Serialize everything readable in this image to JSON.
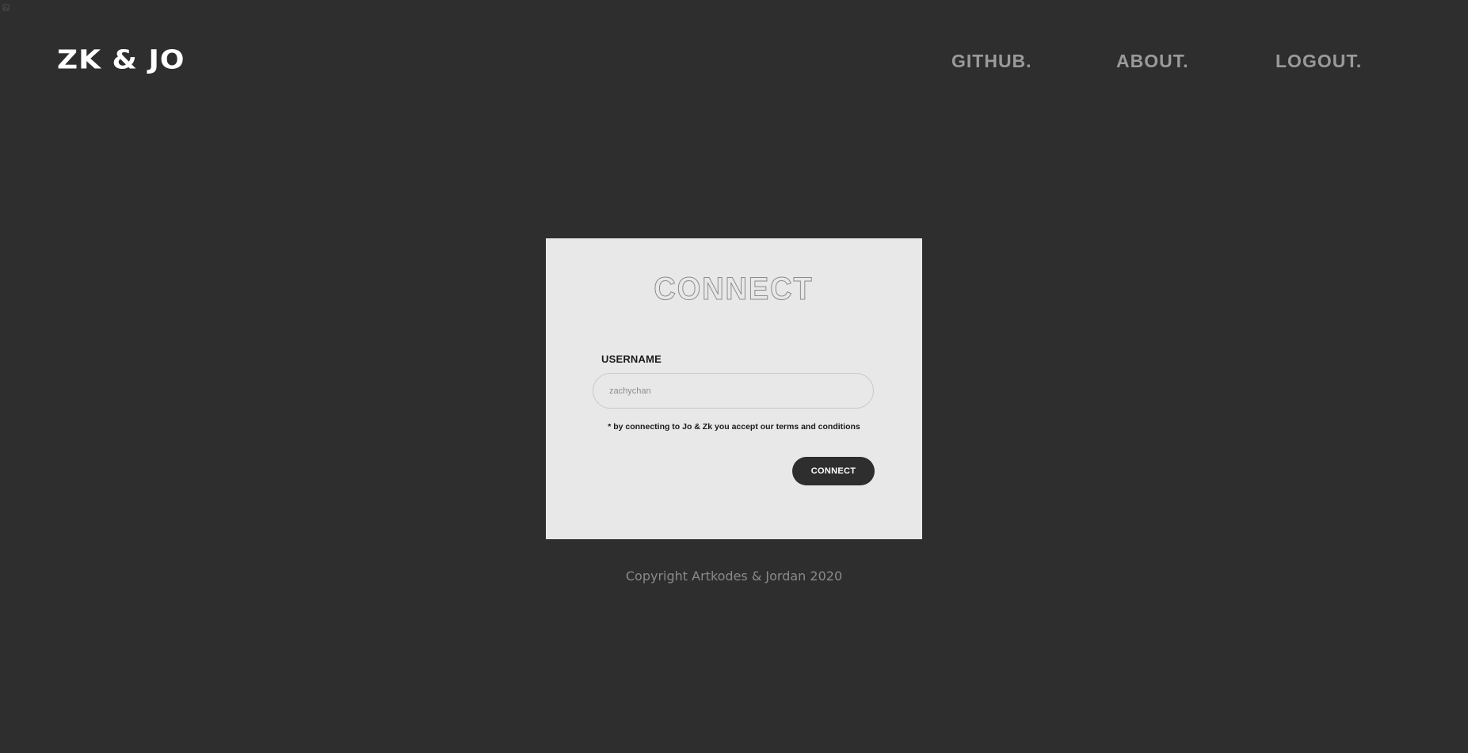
{
  "header": {
    "brand": "ZK & JO",
    "nav": {
      "github": "GITHUB.",
      "about": "ABOUT.",
      "logout": "LOGOUT."
    }
  },
  "card": {
    "title": "CONNECT",
    "username_label": "USERNAME",
    "username_placeholder": "zachychan",
    "terms": "* by connecting to Jo & Zk you accept our terms and conditions",
    "connect_button": "CONNECT"
  },
  "footer": {
    "copyright": "Copyright Artkodes & Jordan 2020"
  },
  "colors": {
    "background": "#2e2e2e",
    "card": "#e8e8e8",
    "nav_text": "#9a9a9a",
    "brand_text": "#ffffff",
    "button": "#2e2e2e"
  },
  "icons": {
    "corner": "broken-image-icon"
  }
}
